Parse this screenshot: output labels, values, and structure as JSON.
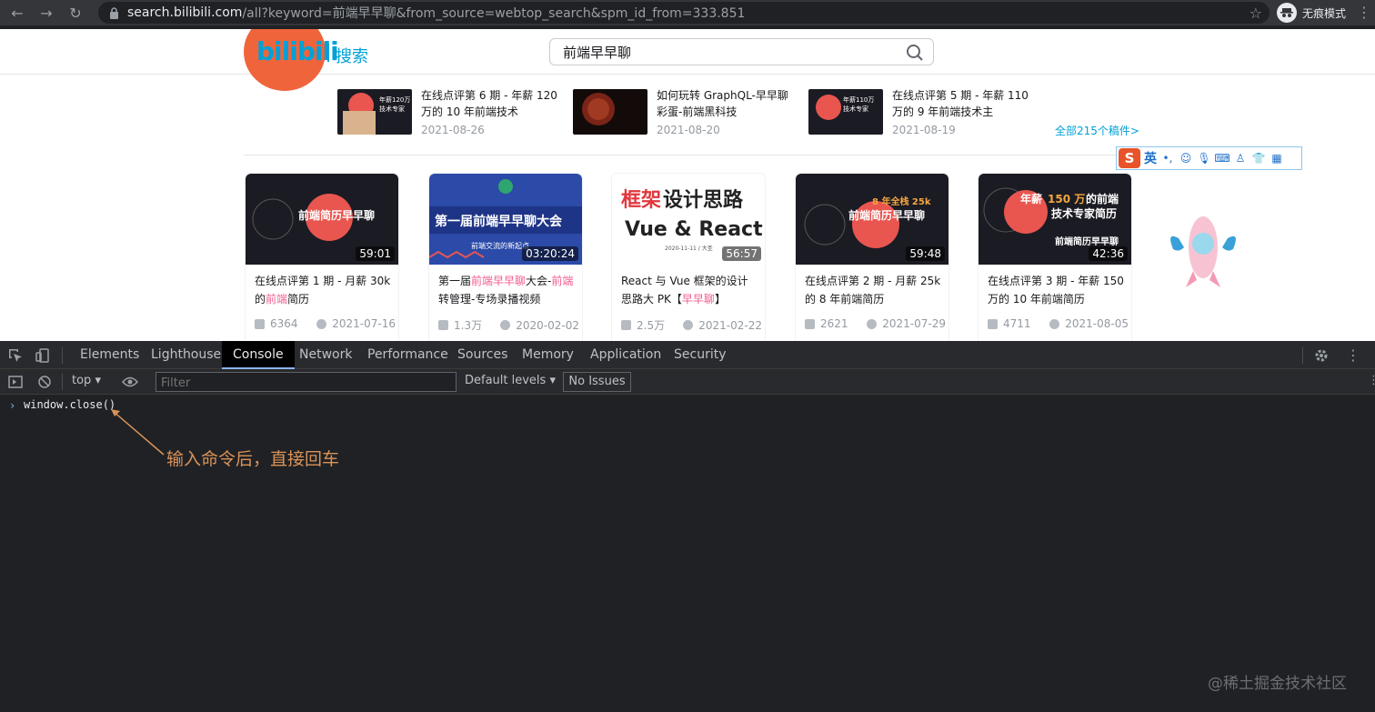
{
  "browser": {
    "url_host": "search.bilibili.com",
    "url_rest": "/all?keyword=前端早早聊&from_source=webtop_search&spm_id_from=333.851",
    "incognito_label": "无痕模式"
  },
  "header": {
    "logo_text": "bilibili",
    "search_label": "搜索",
    "search_value": "前端早早聊"
  },
  "up_videos": [
    {
      "title": "在线点评第 6 期 - 年薪 120 万的 10 年前端技术",
      "date": "2021-08-26",
      "thumb_text": "年薪 120 万的前端技术专家简历"
    },
    {
      "title": "如何玩转 GraphQL-早早聊彩蛋-前端黑科技",
      "date": "2021-08-20",
      "thumb_text": ""
    },
    {
      "title": "在线点评第 5 期 - 年薪 110 万的 9 年前端技术主",
      "date": "2021-08-19",
      "thumb_text": "年薪 110 万的前端技术专家简历"
    }
  ],
  "all_link": "全部215个稿件>",
  "ime": {
    "logo": "S",
    "lang": "英"
  },
  "cards": [
    {
      "thumb_text": "前端简历早早聊",
      "duration": "59:01",
      "title_parts": [
        "在线点评第 1 期 - 月薪 30k 的",
        "前端",
        "简历"
      ],
      "views": "6364",
      "date": "2021-07-16"
    },
    {
      "thumb_text": "第一届前端早早聊大会",
      "thumb_sub": "前端交流的新起点",
      "duration": "03:20:24",
      "title_parts": [
        "第一届",
        "前端早早聊",
        "大会-",
        "前端",
        "转管理-专场录播视频"
      ],
      "views": "1.3万",
      "date": "2020-02-02"
    },
    {
      "thumb_text_a": "框架",
      "thumb_text_b": "设计思路",
      "thumb_text_c": "Vue & React",
      "thumb_sub": "2020-11-11 / 大圣",
      "duration": "56:57",
      "title_parts": [
        "React 与 Vue 框架的设计思路大 PK【",
        "早早聊",
        "】"
      ],
      "views": "2.5万",
      "date": "2021-02-22"
    },
    {
      "thumb_text_a": "8 年全栈 25k",
      "thumb_text": "前端简历早早聊",
      "duration": "59:48",
      "title_parts": [
        "在线点评第 2 期 - 月薪 25k 的 8 年前端简历"
      ],
      "views": "2621",
      "date": "2021-07-29"
    },
    {
      "thumb_text_a": "年薪",
      "thumb_text_b": "150 万",
      "thumb_text_c": "的前端",
      "thumb_text_d": "技术专家简历",
      "thumb_text": "前端简历早早聊",
      "duration": "42:36",
      "title_parts": [
        "在线点评第 3 期 - 年薪 150 万的 10 年前端简历"
      ],
      "views": "4711",
      "date": "2021-08-05"
    }
  ],
  "devtools": {
    "tabs": [
      "Elements",
      "Lighthouse",
      "Console",
      "Network",
      "Performance",
      "Sources",
      "Memory",
      "Application",
      "Security"
    ],
    "active_tab": "Console",
    "context": "top",
    "filter_placeholder": "Filter",
    "levels": "Default levels",
    "issues": "No Issues",
    "command": "window.close()",
    "annotation": "输入命令后，直接回车"
  },
  "watermark": "@稀土掘金技术社区",
  "colors": {
    "accent": "#00a1d6",
    "pink": "#f25d8e",
    "annotation": "#d9935a"
  }
}
